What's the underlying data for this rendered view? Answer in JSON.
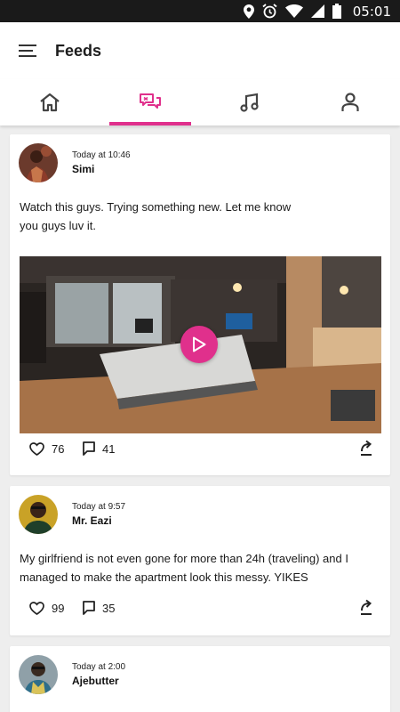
{
  "status_bar": {
    "time": "05:01"
  },
  "app_bar": {
    "title": "Feeds"
  },
  "tabs": [
    {
      "icon": "home-icon",
      "active": false
    },
    {
      "icon": "chat-icon",
      "active": true
    },
    {
      "icon": "music-icon",
      "active": false
    },
    {
      "icon": "profile-icon",
      "active": false
    }
  ],
  "accent_color": "#e0308c",
  "posts": [
    {
      "time": "Today at 10:46",
      "author": "Simi",
      "text": "Watch this guys. Trying something new. Let me know\nyou guys luv it.",
      "has_video": true,
      "likes": "76",
      "comments": "41"
    },
    {
      "time": "Today at 9:57",
      "author": "Mr. Eazi",
      "text": "My girlfriend is not even gone for more than 24h (traveling) and I\nmanaged to make the apartment look this messy. YIKES",
      "has_video": false,
      "likes": "99",
      "comments": "35"
    },
    {
      "time": "Today at 2:00",
      "author": "Ajebutter",
      "text": "",
      "has_video": false
    }
  ]
}
